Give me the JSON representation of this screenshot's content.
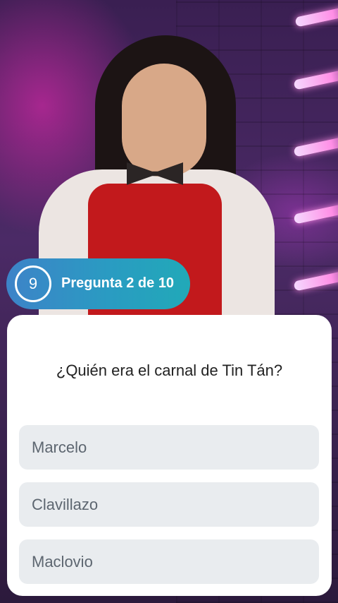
{
  "quiz": {
    "timer_value": "9",
    "question_counter": "Pregunta 2 de 10",
    "question": "¿Quién era el carnal de Tin Tán?",
    "answers": [
      {
        "label": "Marcelo"
      },
      {
        "label": "Clavillazo"
      },
      {
        "label": "Maclovio"
      }
    ]
  },
  "colors": {
    "pill_gradient_start": "#3d83c8",
    "pill_gradient_end": "#21a9b8",
    "card_background": "#ffffff",
    "answer_background": "#e9ecef",
    "answer_text": "#5d6670"
  }
}
